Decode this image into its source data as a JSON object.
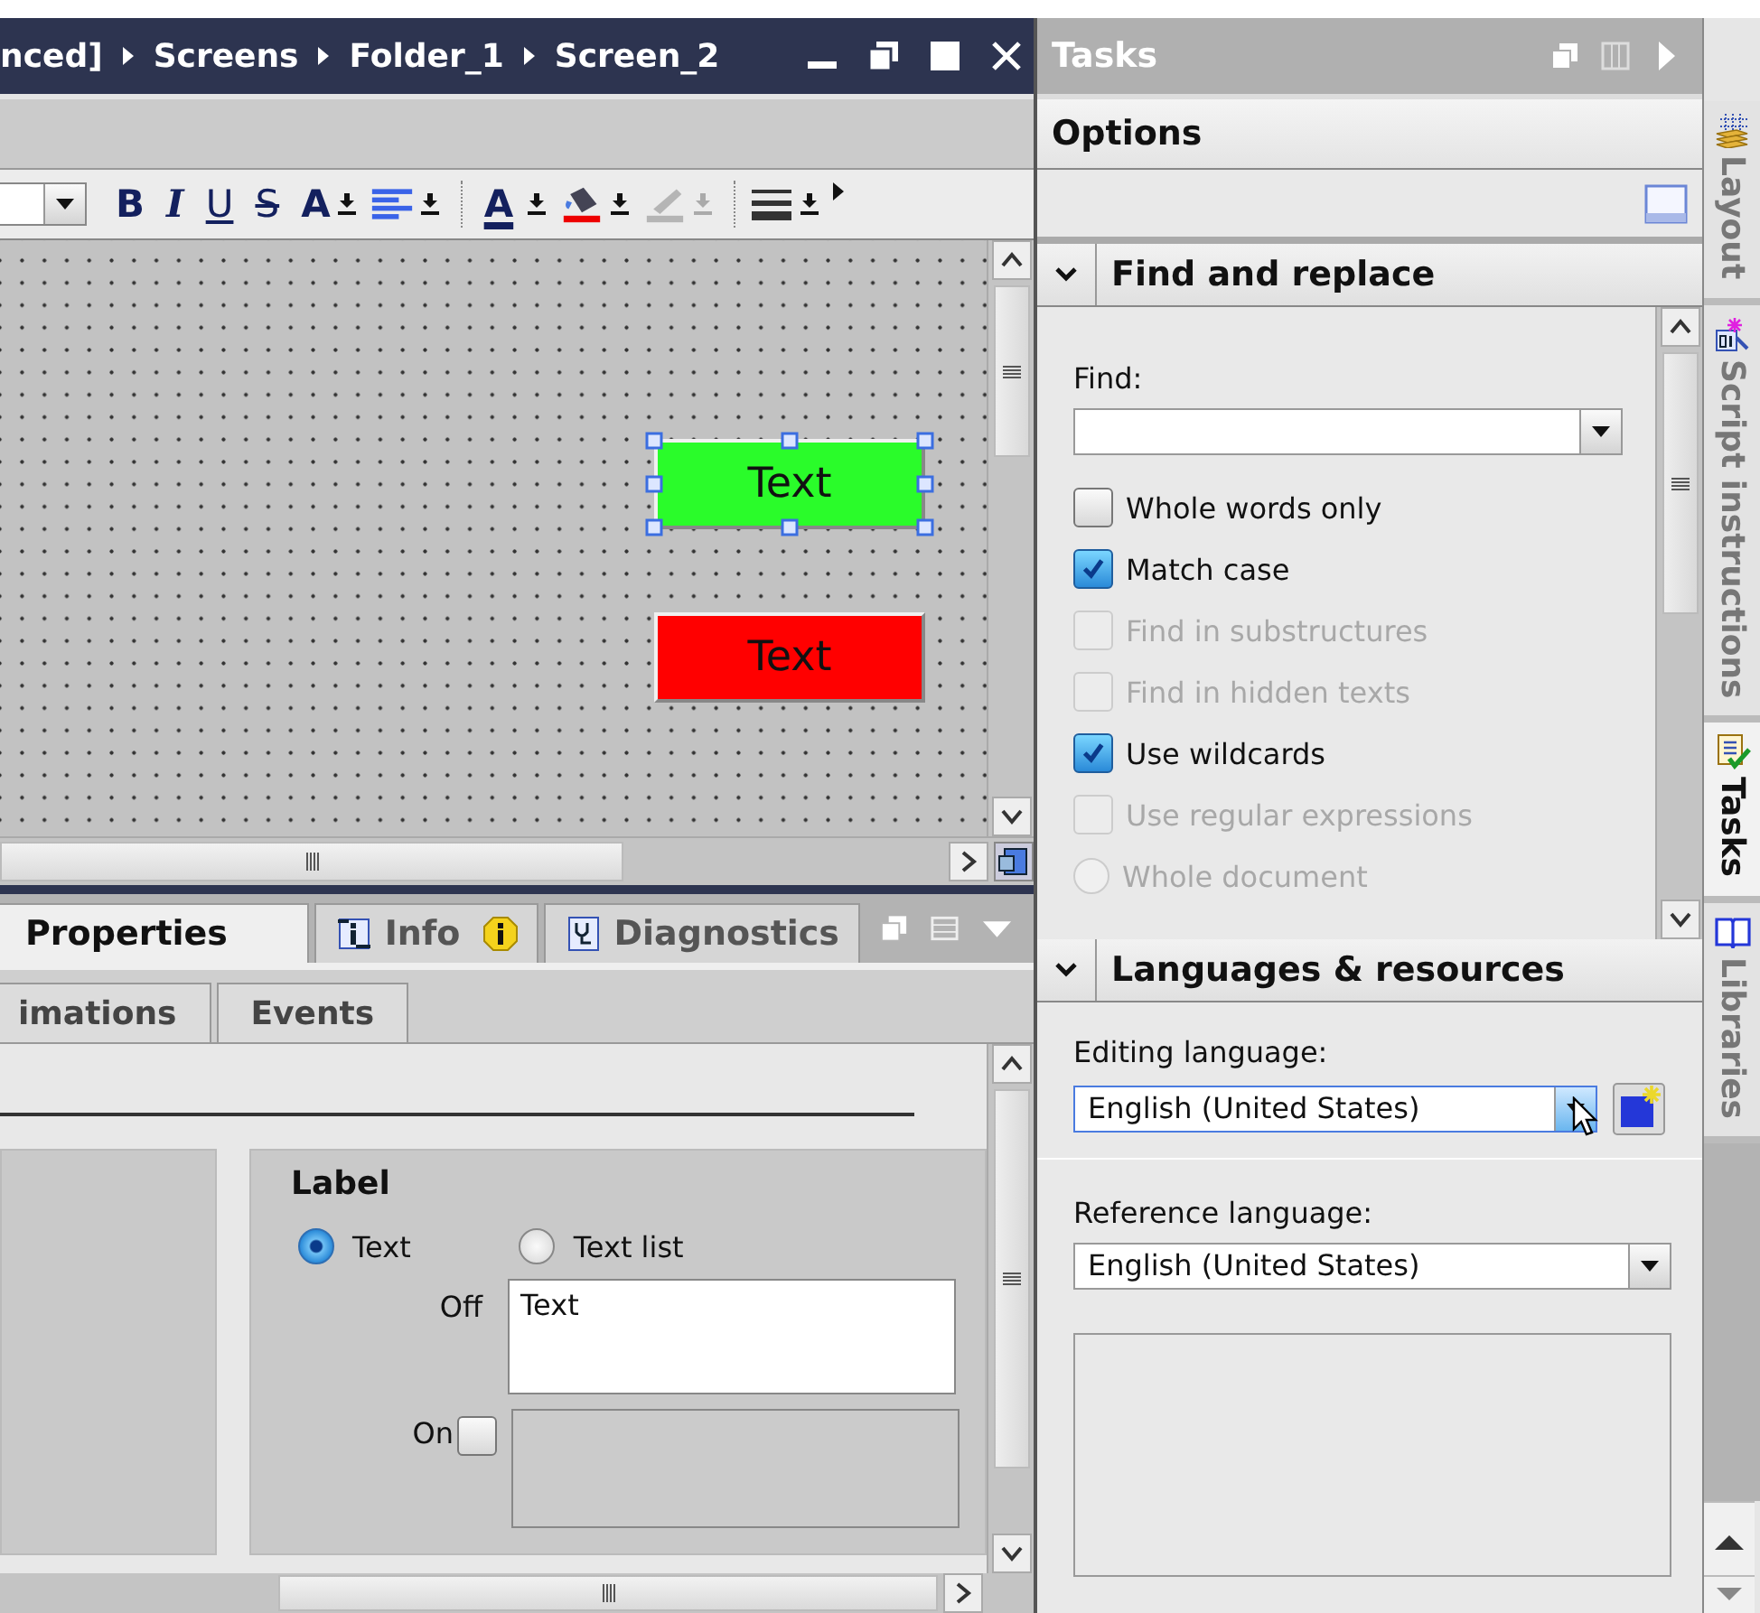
{
  "editor": {
    "breadcrumb": [
      "nced]",
      "Screens",
      "Folder_1",
      "Screen_2"
    ],
    "toolbar": [
      {
        "kind": "bold",
        "label": "B",
        "disabled": false
      },
      {
        "kind": "italic",
        "label": "I",
        "disabled": false
      },
      {
        "kind": "underline",
        "label": "U",
        "disabled": false
      },
      {
        "kind": "strike",
        "label": "S",
        "disabled": false
      },
      {
        "kind": "grow",
        "label": "A",
        "disabled": false
      },
      {
        "kind": "align",
        "disabled": false
      },
      {
        "kind": "fontcolor",
        "label": "A",
        "disabled": false
      },
      {
        "kind": "fill",
        "disabled": false
      },
      {
        "kind": "linecolor",
        "disabled": true
      },
      {
        "kind": "linestyle",
        "disabled": false
      }
    ],
    "canvas_objects": [
      {
        "label": "Text",
        "color": "#2afc2a",
        "selected": true
      },
      {
        "label": "Text",
        "color": "#ff0000",
        "selected": false
      }
    ]
  },
  "inspector": {
    "tabs": [
      {
        "label": "Properties",
        "selected": true
      },
      {
        "label": "Info",
        "selected": false
      },
      {
        "label": "Diagnostics",
        "selected": false
      }
    ],
    "subtabs": [
      {
        "label": "imations",
        "selected": false
      },
      {
        "label": "Events",
        "selected": false
      }
    ],
    "group_title": "Label",
    "radios": [
      {
        "label": "Text",
        "selected": true
      },
      {
        "label": "Text list",
        "selected": false
      }
    ],
    "off_label": "Off",
    "off_value": "Text",
    "on_label": "On",
    "on_checked": false
  },
  "tasks": {
    "title": "Tasks",
    "options_title": "Options",
    "find": {
      "title": "Find and replace",
      "expanded": true,
      "find_label": "Find:",
      "options": [
        {
          "label": "Whole words only",
          "checked": false,
          "disabled": false
        },
        {
          "label": "Match case",
          "checked": true,
          "disabled": false
        },
        {
          "label": "Find in substructures",
          "checked": false,
          "disabled": true
        },
        {
          "label": "Find in hidden texts",
          "checked": false,
          "disabled": true
        },
        {
          "label": "Use wildcards",
          "checked": true,
          "disabled": false
        },
        {
          "label": "Use regular expressions",
          "checked": false,
          "disabled": true
        }
      ],
      "scope": {
        "label": "Whole document",
        "selected": false
      }
    },
    "languages": {
      "title": "Languages & resources",
      "expanded": true,
      "editing_label": "Editing language:",
      "editing_value": "English (United States)",
      "reference_label": "Reference language:",
      "reference_value": "English (United States)"
    }
  },
  "side_tabs": [
    {
      "label": "Layout",
      "selected": false
    },
    {
      "label": "Script instructions",
      "selected": false
    },
    {
      "label": "Tasks",
      "selected": true
    },
    {
      "label": "Libraries",
      "selected": false
    }
  ]
}
